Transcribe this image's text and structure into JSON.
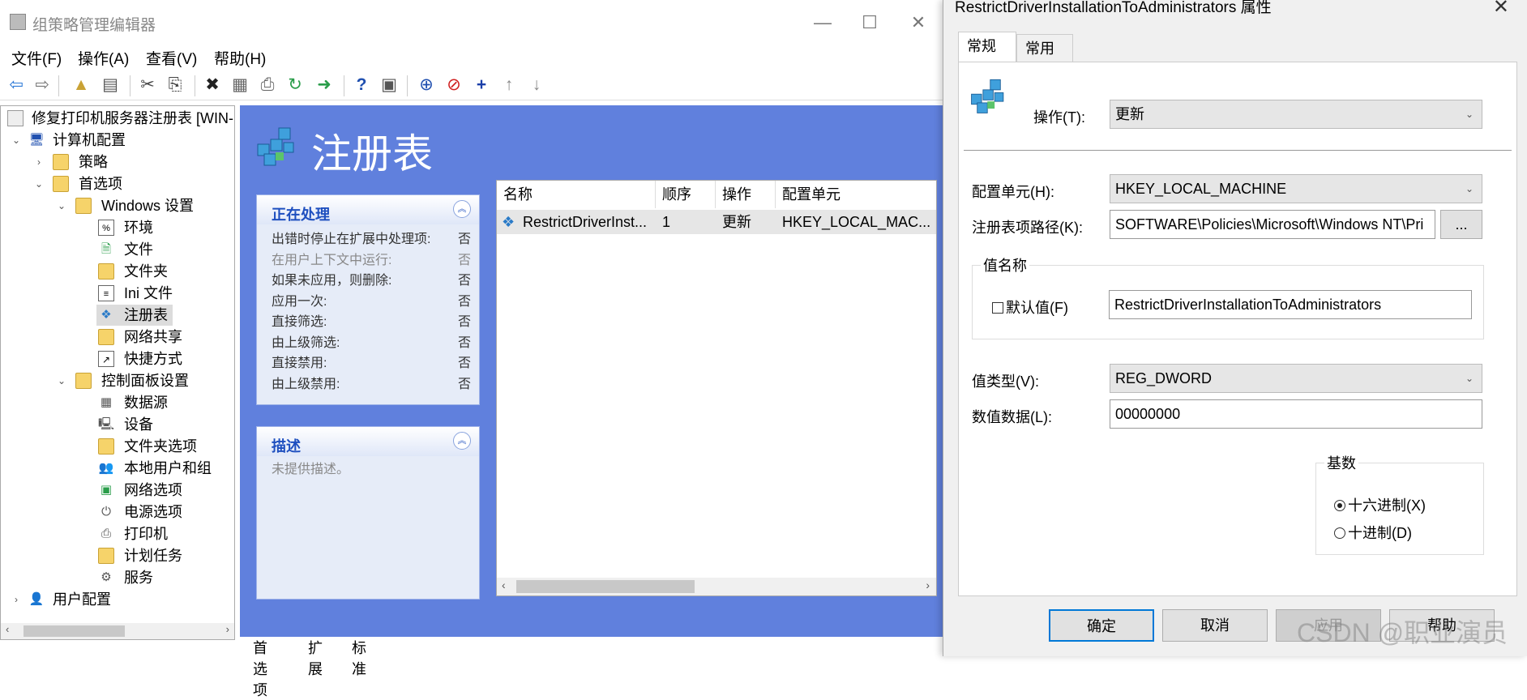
{
  "main": {
    "title": "组策略管理编辑器",
    "menu": [
      "文件(F)",
      "操作(A)",
      "查看(V)",
      "帮助(H)"
    ],
    "tree": {
      "root": "修复打印机服务器注册表 [WIN-",
      "computer_config": "计算机配置",
      "policies": "策略",
      "preferences": "首选项",
      "windows_settings": "Windows 设置",
      "ws_items": [
        "环境",
        "文件",
        "文件夹",
        "Ini 文件",
        "注册表",
        "网络共享",
        "快捷方式"
      ],
      "control_panel": "控制面板设置",
      "cp_items": [
        "数据源",
        "设备",
        "文件夹选项",
        "本地用户和组",
        "网络选项",
        "电源选项",
        "打印机",
        "计划任务",
        "服务"
      ],
      "user_config": "用户配置"
    },
    "pane_title": "注册表",
    "processing": {
      "header": "正在处理",
      "rows": [
        {
          "label": "出错时停止在扩展中处理项:",
          "value": "否"
        },
        {
          "label": "在用户上下文中运行:",
          "value": "否"
        },
        {
          "label": "如果未应用，则删除:",
          "value": "否"
        },
        {
          "label": "应用一次:",
          "value": "否"
        },
        {
          "label": "直接筛选:",
          "value": "否"
        },
        {
          "label": "由上级筛选:",
          "value": "否"
        },
        {
          "label": "直接禁用:",
          "value": "否"
        },
        {
          "label": "由上级禁用:",
          "value": "否"
        }
      ]
    },
    "description": {
      "header": "描述",
      "text": "未提供描述。"
    },
    "list": {
      "columns": [
        "名称",
        "顺序",
        "操作",
        "配置单元"
      ],
      "rows": [
        {
          "name": "RestrictDriverInst...",
          "order": "1",
          "action": "更新",
          "hive": "HKEY_LOCAL_MAC..."
        }
      ]
    },
    "bottom_tabs": [
      "首选项",
      "扩展",
      "标准"
    ]
  },
  "dialog": {
    "title": "RestrictDriverInstallationToAdministrators 属性",
    "tabs": [
      "常规",
      "常用"
    ],
    "action_label": "操作(T):",
    "action_value": "更新",
    "hive_label": "配置单元(H):",
    "hive_value": "HKEY_LOCAL_MACHINE",
    "key_path_label": "注册表项路径(K):",
    "key_path_value": "SOFTWARE\\Policies\\Microsoft\\Windows NT\\Pri",
    "browse_label": "...",
    "value_name_group": "值名称",
    "default_value_label": "默认值(F)",
    "value_name": "RestrictDriverInstallationToAdministrators",
    "value_type_label": "值类型(V):",
    "value_type": "REG_DWORD",
    "value_data_label": "数值数据(L):",
    "value_data": "00000000",
    "base_group": "基数",
    "base_hex": "十六进制(X)",
    "base_dec": "十进制(D)",
    "buttons": {
      "ok": "确定",
      "cancel": "取消",
      "apply": "应用",
      "help": "帮助"
    }
  },
  "watermark": "CSDN @职业演员"
}
